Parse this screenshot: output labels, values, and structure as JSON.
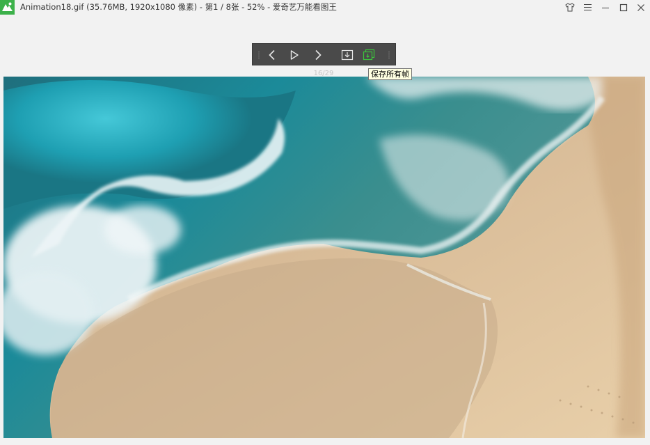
{
  "window": {
    "title": "Animation18.gif (35.76MB, 1920x1080 像素) - 第1 / 8张 - 52% - 爱奇艺万能看图王"
  },
  "titlebar_buttons": {
    "skin": "shirt-icon",
    "menu": "menu-icon",
    "minimize": "minimize-icon",
    "maximize": "maximize-icon",
    "close": "close-icon"
  },
  "toolbar": {
    "prev": "chevron-left-icon",
    "play": "play-icon",
    "next": "chevron-right-icon",
    "save_frame": "download-icon",
    "save_all_frames": "save-all-frames-icon"
  },
  "frame_counter": "16/29",
  "tooltip": "保存所有帧",
  "colors": {
    "brand": "#3cb14a",
    "toolbar_bg": "#4a4a4a",
    "accent_green": "#3cc43c"
  }
}
